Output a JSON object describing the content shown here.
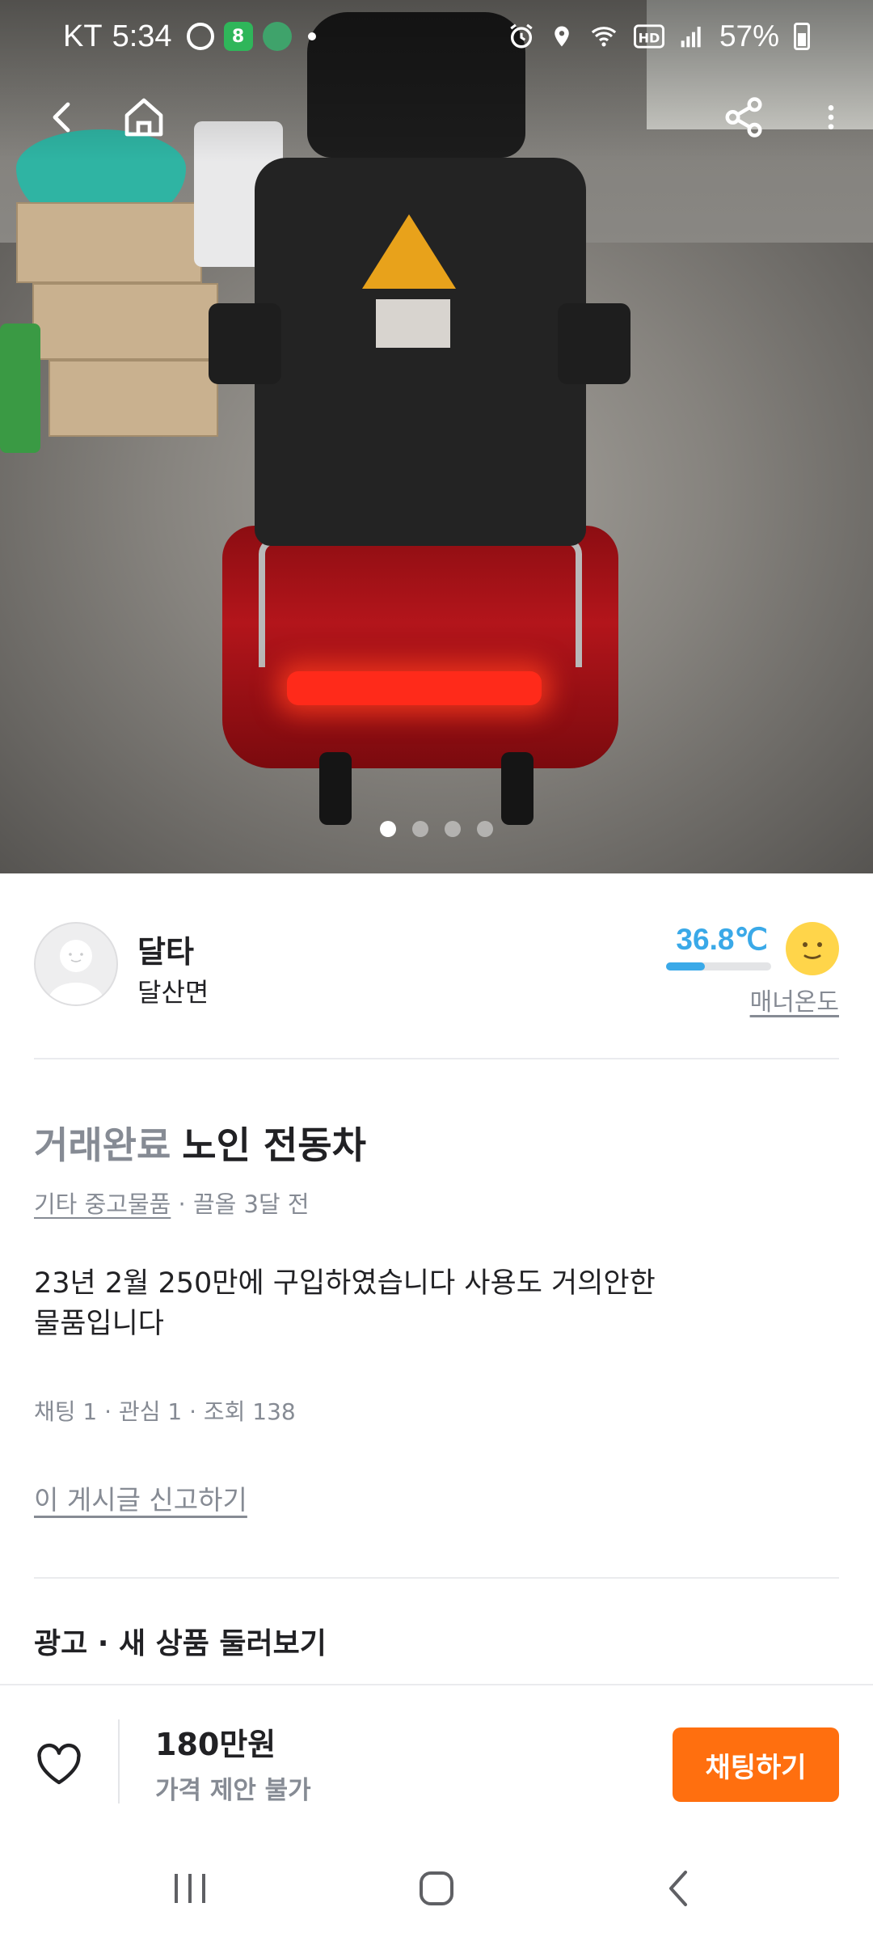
{
  "status_bar": {
    "carrier": "KT",
    "time": "5:34",
    "battery": "57%",
    "icons_left": [
      "chrome-icon",
      "green-badge-icon",
      "app-badge-icon",
      "dot-icon"
    ],
    "icons_right": [
      "alarm-icon",
      "location-icon",
      "wifi-icon",
      "hd-icon",
      "signal-icon",
      "battery-icon"
    ],
    "badge_label": "8"
  },
  "top_nav": {
    "icons": [
      "back-arrow-icon",
      "home-icon",
      "share-icon",
      "more-vert-icon"
    ]
  },
  "gallery": {
    "image_count": 4,
    "active_index": 0
  },
  "seller": {
    "name": "달타",
    "location": "달산면",
    "manner_temp": "36.8℃",
    "manner_temp_level": 0.368,
    "manner_label": "매너온도"
  },
  "article": {
    "status": "거래완료",
    "title": "노인 전동차",
    "category": "기타 중고물품",
    "meta_suffix": " · 끌올 3달 전",
    "description": "23년 2월 250만에 구입하였습니다 사용도 거의안한\n물품입니다",
    "counts": "채팅 1 · 관심 1 · 조회 138",
    "report_link": "이 게시글 신고하기"
  },
  "ad_section": {
    "title": "광고 · 새 상품 둘러보기"
  },
  "action_bar": {
    "price": "180만원",
    "price_note": "가격 제안 불가",
    "chat_button": "채팅하기"
  },
  "colors": {
    "accent": "#ff6f0f",
    "temp_blue": "#3aa9e8",
    "muted_text": "#868b94"
  },
  "system_nav": {
    "icons": [
      "recent-apps-icon",
      "home-circle-icon",
      "back-chevron-icon"
    ]
  }
}
